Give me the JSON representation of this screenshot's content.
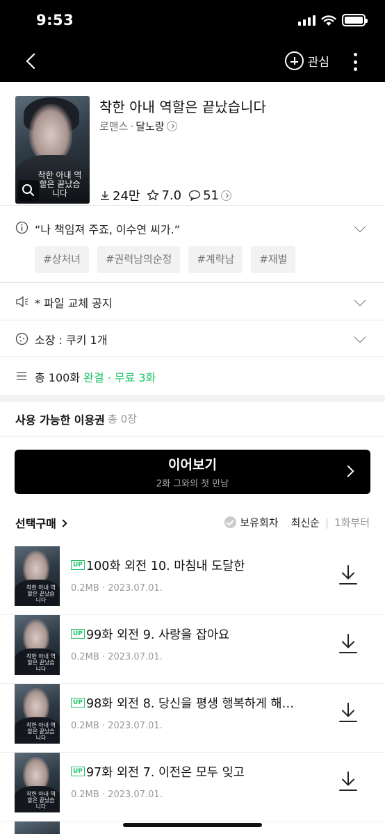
{
  "status_bar": {
    "time": "9:53"
  },
  "nav": {
    "follow_label": "관심"
  },
  "book": {
    "title": "착한 아내 역할은 끝났습니다",
    "genre": "로맨스",
    "separator": "·",
    "author": "달노랑",
    "cover_title": "착한 아내 역할은 끝났습니다",
    "downloads": "24만",
    "rating": "7.0",
    "comments": "51"
  },
  "info_rows": {
    "quote": "“나 책임져 주죠, 이수연 씨가.”",
    "tags": [
      "#상처녀",
      "#권력남의순정",
      "#계략남",
      "#재벌"
    ],
    "notice": "* 파일 교체 공지",
    "owned": "소장 : 쿠키 1개",
    "total_prefix": "총 100화",
    "total_status": "완결 · 무료 3화"
  },
  "coupon": {
    "label": "사용 가능한 이용권",
    "count": "총 0장"
  },
  "continue": {
    "label": "이어보기",
    "episode": "2화 그와의 첫 만남"
  },
  "list": {
    "select_purchase": "선택구매",
    "owned_filter": "보유회차",
    "sort_latest": "최신순",
    "divider": "|",
    "sort_first": "1화부터",
    "up_badge": "UP",
    "episodes": [
      {
        "title": "100화 외전 10. 마침내 도달한",
        "meta": "0.2MB · 2023.07.01."
      },
      {
        "title": "99화 외전 9. 사랑을 잡아요",
        "meta": "0.2MB · 2023.07.01."
      },
      {
        "title": "98화 외전 8. 당신을 평생 행복하게 해…",
        "meta": "0.2MB · 2023.07.01."
      },
      {
        "title": "97화 외전 7. 이전은 모두 잊고",
        "meta": "0.2MB · 2023.07.01."
      }
    ]
  },
  "colors": {
    "accent_green": "#1fc46a",
    "header_bg": "#000000"
  }
}
